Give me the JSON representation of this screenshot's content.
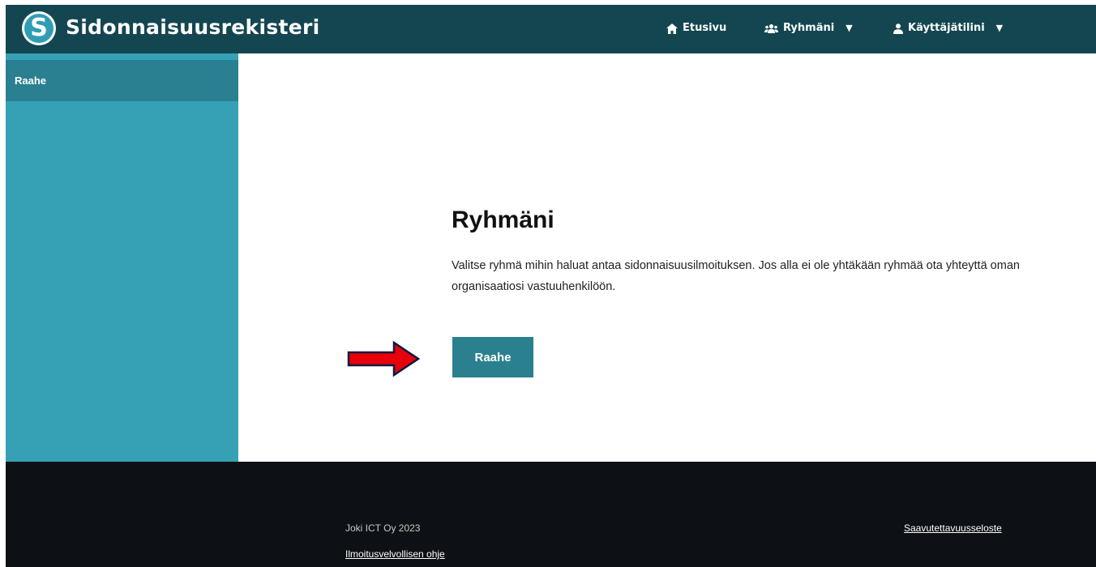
{
  "header": {
    "logo_letter": "S",
    "app_title": "Sidonnaisuusrekisteri",
    "nav": {
      "home": "Etusivu",
      "groups": "Ryhmäni",
      "account": "Käyttäjätilini",
      "caret": "▼"
    }
  },
  "sidebar": {
    "items": [
      {
        "label": "Raahe"
      }
    ]
  },
  "main": {
    "title": "Ryhmäni",
    "description": "Valitse ryhmä mihin haluat antaa sidonnaisuusilmoituksen. Jos alla ei ole yhtäkään ryhmää ota yhteyttä oman organisaatiosi vastuuhenkilöön.",
    "group_button": "Raahe"
  },
  "footer": {
    "copyright": "Joki ICT Oy 2023",
    "guide_link": "Ilmoitusvelvollisen ohje",
    "accessibility_link": "Saavutettavuusseloste"
  },
  "colors": {
    "header_bg": "#134650",
    "sidebar_bg": "#36a1b5",
    "sidebar_active": "#2a8090",
    "button_bg": "#2a808e",
    "footer_bg": "#0d1014",
    "arrow_red": "#e8000b"
  },
  "icons": {
    "home": "home-icon",
    "groups": "users-icon",
    "account": "user-icon",
    "annotation": "red-arrow-icon"
  }
}
